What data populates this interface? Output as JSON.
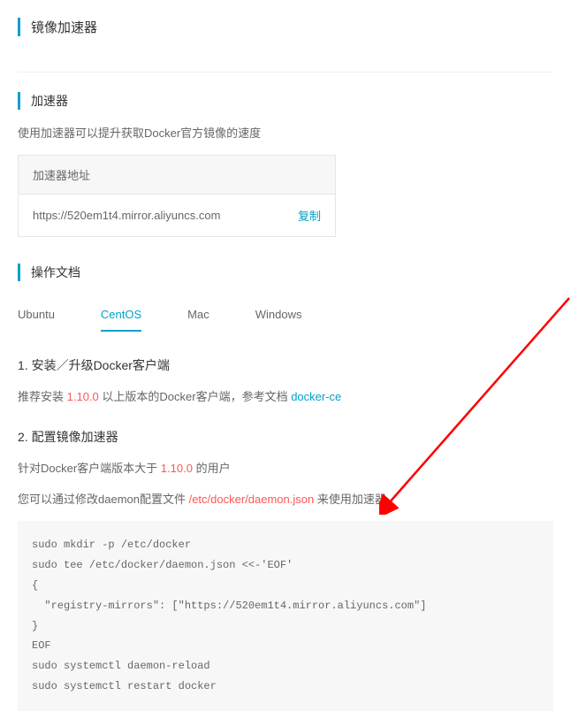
{
  "page_title": "镜像加速器",
  "accelerator": {
    "title": "加速器",
    "desc": "使用加速器可以提升获取Docker官方镜像的速度",
    "address_label": "加速器地址",
    "url": "https://520em1t4.mirror.aliyuncs.com",
    "copy_label": "复制"
  },
  "docs": {
    "title": "操作文档",
    "tabs": [
      {
        "label": "Ubuntu",
        "active": false
      },
      {
        "label": "CentOS",
        "active": true
      },
      {
        "label": "Mac",
        "active": false
      },
      {
        "label": "Windows",
        "active": false
      }
    ]
  },
  "step1": {
    "title": "1. 安装／升级Docker客户端",
    "text_prefix": "推荐安装 ",
    "version": "1.10.0",
    "text_mid": " 以上版本的Docker客户端，参考文档 ",
    "link": "docker-ce"
  },
  "step2": {
    "title": "2. 配置镜像加速器",
    "line1_prefix": "针对Docker客户端版本大于 ",
    "line1_version": "1.10.0",
    "line1_suffix": " 的用户",
    "line2_prefix": "您可以通过修改daemon配置文件 ",
    "line2_path": "/etc/docker/daemon.json",
    "line2_suffix": " 来使用加速器",
    "code": "sudo mkdir -p /etc/docker\nsudo tee /etc/docker/daemon.json <<-'EOF'\n{\n  \"registry-mirrors\": [\"https://520em1t4.mirror.aliyuncs.com\"]\n}\nEOF\nsudo systemctl daemon-reload\nsudo systemctl restart docker"
  }
}
